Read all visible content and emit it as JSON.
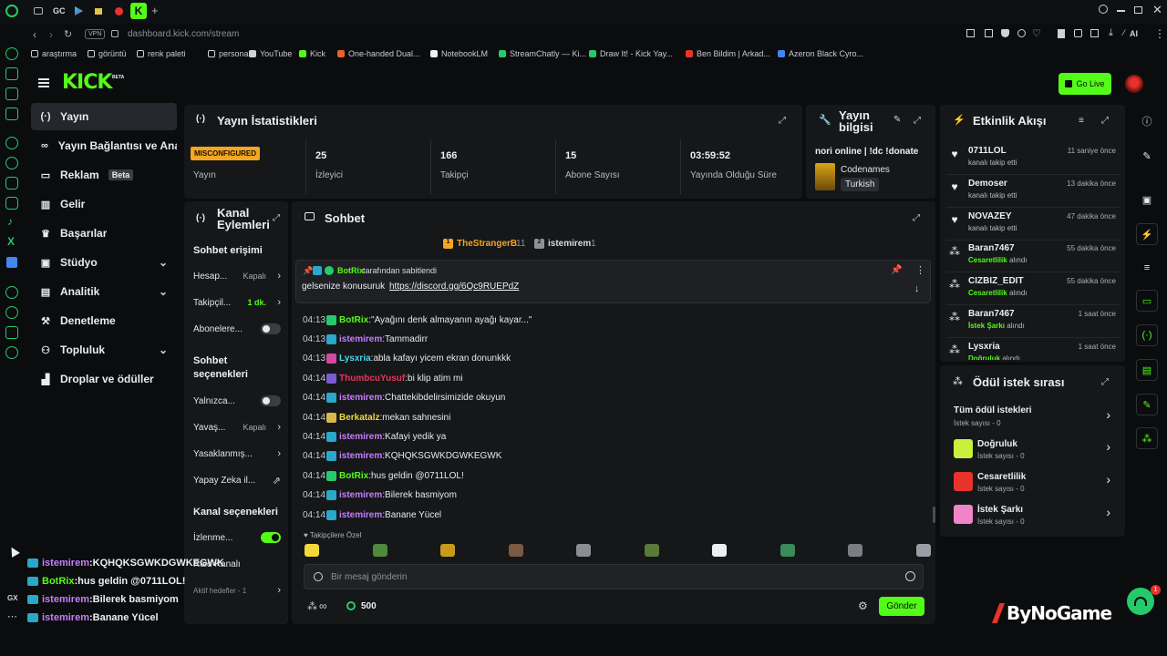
{
  "browser": {
    "tabs": [
      "GC"
    ],
    "url": "dashboard.kick.com/stream",
    "vpn_label": "VPN",
    "ai_label": "AI",
    "bookmarks": [
      "araştırma",
      "görüntü",
      "renk paleti",
      "personal",
      "YouTube",
      "Kick",
      "One-handed Dual...",
      "NotebookLM",
      "StreamChatly — Ki...",
      "Draw It! - Kick Yay...",
      "Ben Bildim | Arkad...",
      "Azeron Black Cyro..."
    ],
    "sidebar_bottom_label": "GX"
  },
  "header": {
    "logo": "KICK",
    "logo_badge": "BETA",
    "go_live_label": "Go Live"
  },
  "nav": {
    "items": [
      {
        "label": "Yayın",
        "icon": "broadcast-icon",
        "active": true
      },
      {
        "label": "Yayın Bağlantısı ve Anahtarı",
        "icon": "link-icon"
      },
      {
        "label": "Reklam",
        "icon": "ad-icon",
        "badge": "Beta"
      },
      {
        "label": "Gelir",
        "icon": "chart-icon"
      },
      {
        "label": "Başarılar",
        "icon": "trophy-icon"
      },
      {
        "label": "Stüdyo",
        "icon": "studio-icon",
        "expandable": true
      },
      {
        "label": "Analitik",
        "icon": "analytics-icon",
        "expandable": true
      },
      {
        "label": "Denetleme",
        "icon": "hammer-icon"
      },
      {
        "label": "Topluluk",
        "icon": "community-icon",
        "expandable": true
      },
      {
        "label": "Droplar ve ödüller",
        "icon": "drops-icon"
      }
    ]
  },
  "stats": {
    "title": "Yayın İstatistikleri",
    "items": [
      {
        "value": "MISCONFIGURED",
        "label": "Yayın"
      },
      {
        "value": "25",
        "label": "İzleyici"
      },
      {
        "value": "166",
        "label": "Takipçi"
      },
      {
        "value": "15",
        "label": "Abone Sayısı"
      },
      {
        "value": "03:59:52",
        "label": "Yayında Olduğu Süre"
      }
    ]
  },
  "stream_info": {
    "title": "Yayın bilgisi",
    "stream_title": "nori online | !dc !donate",
    "category": "Codenames",
    "language": "Turkish"
  },
  "channel_actions": {
    "title": "Kanal Eylemleri",
    "chat_access_title": "Sohbet erişimi",
    "chat_access": [
      {
        "label": "Hesap...",
        "value": "Kapalı",
        "type": "arrow"
      },
      {
        "label": "Takipçil...",
        "value": "1 dk.",
        "type": "arrow",
        "accent": true
      },
      {
        "label": "Abonelere...",
        "type": "toggle",
        "on": false
      }
    ],
    "chat_options_title": "Sohbet seçenekleri",
    "chat_options": [
      {
        "label": "Yalnızca...",
        "type": "toggle",
        "on": false
      },
      {
        "label": "Yavaş...",
        "value": "Kapalı",
        "type": "arrow"
      },
      {
        "label": "Yasaklanmış...",
        "type": "arrow"
      },
      {
        "label": "Yapay Zeka il...",
        "type": "external"
      }
    ],
    "channel_options_title": "Kanal seçenekleri",
    "channel_options": [
      {
        "label": "İzlenme...",
        "type": "toggle",
        "on": true
      },
      {
        "label": "Raid Kanalı",
        "type": "none"
      },
      {
        "label": "Aktif hedefler - 1",
        "type": "arrow"
      }
    ]
  },
  "chat": {
    "title": "Sohbet",
    "top_chatters": [
      {
        "name": "TheStrangerB",
        "count": "11"
      },
      {
        "name": "istemirem",
        "count": "1"
      }
    ],
    "pinned": {
      "by": "BotRix",
      "by_suffix": "tarafından sabitlendi",
      "text": "gelsenize konusuruk",
      "link": "https://discord.gg/6Qc9RUEPdZ"
    },
    "messages": [
      {
        "time": "04:13",
        "user": "BotRix",
        "text": "\"Ayağını denk almayanın ayağı kayar...\"",
        "color": "#53fc18",
        "badge": "#26c96b"
      },
      {
        "time": "04:13",
        "user": "istemirem",
        "text": "Tammadirr",
        "color": "#c77dff",
        "badge": "#2aa7c9"
      },
      {
        "time": "04:13",
        "user": "Lysxria",
        "text": "abla kafayı yicem ekran donunkkk",
        "color": "#4fd6e8",
        "badge": "#d14a9b"
      },
      {
        "time": "04:14",
        "user": "ThumbcuYusuf",
        "text": "bi klip atim mi",
        "color": "#e8355a",
        "badge": "#7a5bd1"
      },
      {
        "time": "04:14",
        "user": "istemirem",
        "text": "Chattekibdelirsimizide okuyun",
        "color": "#c77dff",
        "badge": "#2aa7c9"
      },
      {
        "time": "04:14",
        "user": "Berkatalz",
        "text": "mekan sahnesini",
        "color": "#f4d83a",
        "badge": "#d9b84a"
      },
      {
        "time": "04:14",
        "user": "istemirem",
        "text": "Kafayi yedik ya",
        "color": "#c77dff",
        "badge": "#2aa7c9"
      },
      {
        "time": "04:14",
        "user": "istemirem",
        "text": "KQHQKSGWKDGWKEGWK",
        "color": "#c77dff",
        "badge": "#2aa7c9"
      },
      {
        "time": "04:14",
        "user": "BotRix",
        "text": "hus geldin @0711LOL!",
        "color": "#53fc18",
        "badge": "#26c96b"
      },
      {
        "time": "04:14",
        "user": "istemirem",
        "text": "Bilerek basmiyom",
        "color": "#c77dff",
        "badge": "#2aa7c9"
      },
      {
        "time": "04:14",
        "user": "istemirem",
        "text": "Banane Yücel",
        "color": "#c77dff",
        "badge": "#2aa7c9"
      }
    ],
    "emote_section_label": "Takipçilere Özel",
    "input_placeholder": "Bir mesaj gönderin",
    "points": "500",
    "send_label": "Gönder"
  },
  "activity": {
    "title": "Etkinlik Akışı",
    "items": [
      {
        "name": "0711LOL",
        "sub": "kanalı takip etti",
        "time": "11 saniye önce",
        "kind": "follow"
      },
      {
        "name": "Demoser",
        "sub": "kanalı takip etti",
        "time": "13 dakika önce",
        "kind": "follow"
      },
      {
        "name": "NOVAZEY",
        "sub": "kanalı takip etti",
        "time": "47 dakika önce",
        "kind": "follow"
      },
      {
        "name": "Baran7467",
        "sub_hl": "Cesaretlilik",
        "sub": "alındı",
        "time": "55 dakika önce",
        "kind": "reward"
      },
      {
        "name": "CIZBIZ_EDIT",
        "sub_hl": "Cesaretlilik",
        "sub": "alındı",
        "time": "55 dakika önce",
        "kind": "reward"
      },
      {
        "name": "Baran7467",
        "sub_hl": "İstek Şarkı",
        "sub": "alındı",
        "time": "1 saat önce",
        "kind": "reward"
      },
      {
        "name": "Lysxria",
        "sub_hl": "Doğruluk",
        "sub": "alındı",
        "time": "1 saat önce",
        "kind": "reward"
      }
    ]
  },
  "rewards": {
    "title": "Ödül istek sırası",
    "all_label": "Tüm ödül istekleri",
    "all_count": "İstek sayısı - 0",
    "items": [
      {
        "label": "Doğruluk",
        "count": "İstek sayısı - 0",
        "color": "#c8f03c"
      },
      {
        "label": "Cesaretlilik",
        "count": "İstek sayısı - 0",
        "color": "#e8332a"
      },
      {
        "label": "İstek Şarkı",
        "count": "İstek sayısı - 0",
        "color": "#f084c8"
      }
    ]
  },
  "overlay_chat": [
    {
      "user": "istemirem",
      "text": "KQHQKSGWKDGWKEGWK",
      "color": "#c77dff"
    },
    {
      "user": "BotRix",
      "text": "hus geldin @0711LOL!",
      "color": "#53fc18"
    },
    {
      "user": "istemirem",
      "text": "Bilerek basmiyom",
      "color": "#c77dff"
    },
    {
      "user": "istemirem",
      "text": "Banane Yücel",
      "color": "#c77dff"
    }
  ],
  "watermark": "ByNoGame",
  "notification_count": "1",
  "colors": {
    "accent": "#53fc18",
    "panel": "#151719",
    "bg": "#0b0c0e"
  }
}
